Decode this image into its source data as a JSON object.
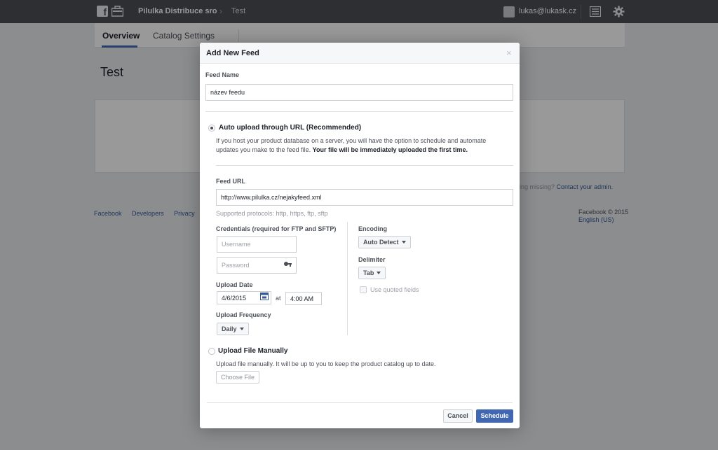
{
  "topbar": {
    "business_name": "Pilulka Distribuce sro",
    "breadcrumb_sep": "›",
    "breadcrumb": "Test",
    "user": "lukas@lukask.cz"
  },
  "tabs": [
    {
      "label": "Overview"
    },
    {
      "label": "Catalog Settings"
    }
  ],
  "page_title": "Test",
  "missing": {
    "text": "ing missing?",
    "link": "Contact your admin."
  },
  "footer": {
    "links": [
      "Facebook",
      "Developers",
      "Privacy"
    ],
    "copyright": "Facebook © 2015",
    "language": "English (US)"
  },
  "dialog": {
    "title": "Add New Feed",
    "close": "×",
    "feed_name_label": "Feed Name",
    "feed_name_value": "název feedu",
    "auto_upload": {
      "label": "Auto upload through URL (Recommended)",
      "desc_line1": "If you host your product database on a server, you will have the option to schedule and automate",
      "desc_line2_plain": "updates you make to the feed file.",
      "desc_line2_bold": "Your file will be immediately uploaded the first time."
    },
    "feed_url_label": "Feed URL",
    "feed_url_value": "http://www.pilulka.cz/nejakyfeed.xml",
    "protocols_hint": "Supported protocols: http, https, ftp, sftp",
    "credentials_label": "Credentials (required for FTP and SFTP)",
    "username_placeholder": "Username",
    "password_placeholder": "Password",
    "upload_date_label": "Upload Date",
    "upload_date_value": "4/6/2015",
    "at_label": "at",
    "upload_time_value": "4:00 AM",
    "upload_frequency_label": "Upload Frequency",
    "upload_frequency_value": "Daily",
    "encoding_label": "Encoding",
    "encoding_value": "Auto Detect",
    "delimiter_label": "Delimiter",
    "delimiter_value": "Tab",
    "quoted_fields_label": "Use quoted fields",
    "manual_upload": {
      "label": "Upload File Manually",
      "desc": "Upload file manually. It will be up to you to keep the product catalog up to date.",
      "choose_file": "Choose File"
    },
    "cancel_label": "Cancel",
    "schedule_label": "Schedule"
  },
  "colors": {
    "topbar": "#4b4f56",
    "primary_button": "#4267b2",
    "link": "#365899"
  }
}
